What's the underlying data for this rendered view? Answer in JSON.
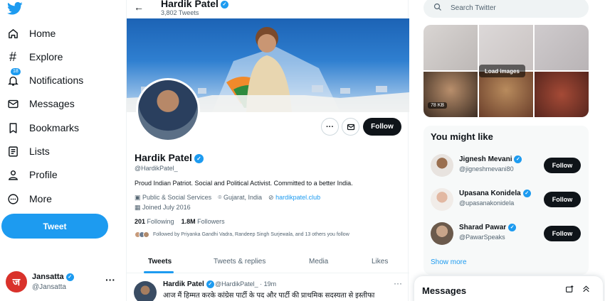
{
  "colors": {
    "accent": "#1d9bf0",
    "text": "#0f1419",
    "muted": "#536471"
  },
  "nav": {
    "items": [
      {
        "label": "Home",
        "icon": "home-icon"
      },
      {
        "label": "Explore",
        "icon": "hashtag-icon"
      },
      {
        "label": "Notifications",
        "icon": "bell-icon",
        "badge": "18"
      },
      {
        "label": "Messages",
        "icon": "envelope-icon"
      },
      {
        "label": "Bookmarks",
        "icon": "bookmark-icon"
      },
      {
        "label": "Lists",
        "icon": "list-icon"
      },
      {
        "label": "Profile",
        "icon": "person-icon"
      },
      {
        "label": "More",
        "icon": "more-circle-icon"
      }
    ],
    "tweet_button": "Tweet",
    "account": {
      "name": "Jansatta",
      "handle": "@Jansatta",
      "avatar_text": "ज"
    }
  },
  "header": {
    "name": "Hardik Patel",
    "tweet_count": "3,802 Tweets"
  },
  "profile": {
    "name": "Hardik Patel",
    "handle": "@HardikPatel_",
    "bio": "Proud Indian Patriot. Social and Political Activist. Committed to a better India.",
    "category": "Public & Social Services",
    "location": "Gujarat, India",
    "website": "hardikpatel.club",
    "joined": "Joined July 2016",
    "following_count": "201",
    "following_label": "Following",
    "followers_count": "1.8M",
    "followers_label": "Followers",
    "known_followers": "Followed by Priyanka Gandhi Vadra, Randeep Singh Surjewala, and 13 others you follow",
    "follow_button": "Follow"
  },
  "tabs": [
    "Tweets",
    "Tweets & replies",
    "Media",
    "Likes"
  ],
  "tweet": {
    "name": "Hardik Patel",
    "handle_time": "@HardikPatel_ · 19m",
    "text": "आज मैं हिम्मत करके कांग्रेस पार्टी के पद और पार्टी की प्राथमिक सदस्यता से इस्तीफा"
  },
  "search": {
    "placeholder": "Search Twitter"
  },
  "media": {
    "load_label": "Load images",
    "size": "78 KB"
  },
  "you_might_like": {
    "title": "You might like",
    "users": [
      {
        "name": "Jignesh Mevani",
        "handle": "@jigneshmevani80",
        "button": "Follow"
      },
      {
        "name": "Upasana Konidela",
        "handle": "@upasanakonidela",
        "button": "Follow"
      },
      {
        "name": "Sharad Pawar",
        "handle": "@PawarSpeaks",
        "button": "Follow"
      }
    ],
    "show_more": "Show more"
  },
  "messages_drawer": {
    "title": "Messages"
  }
}
